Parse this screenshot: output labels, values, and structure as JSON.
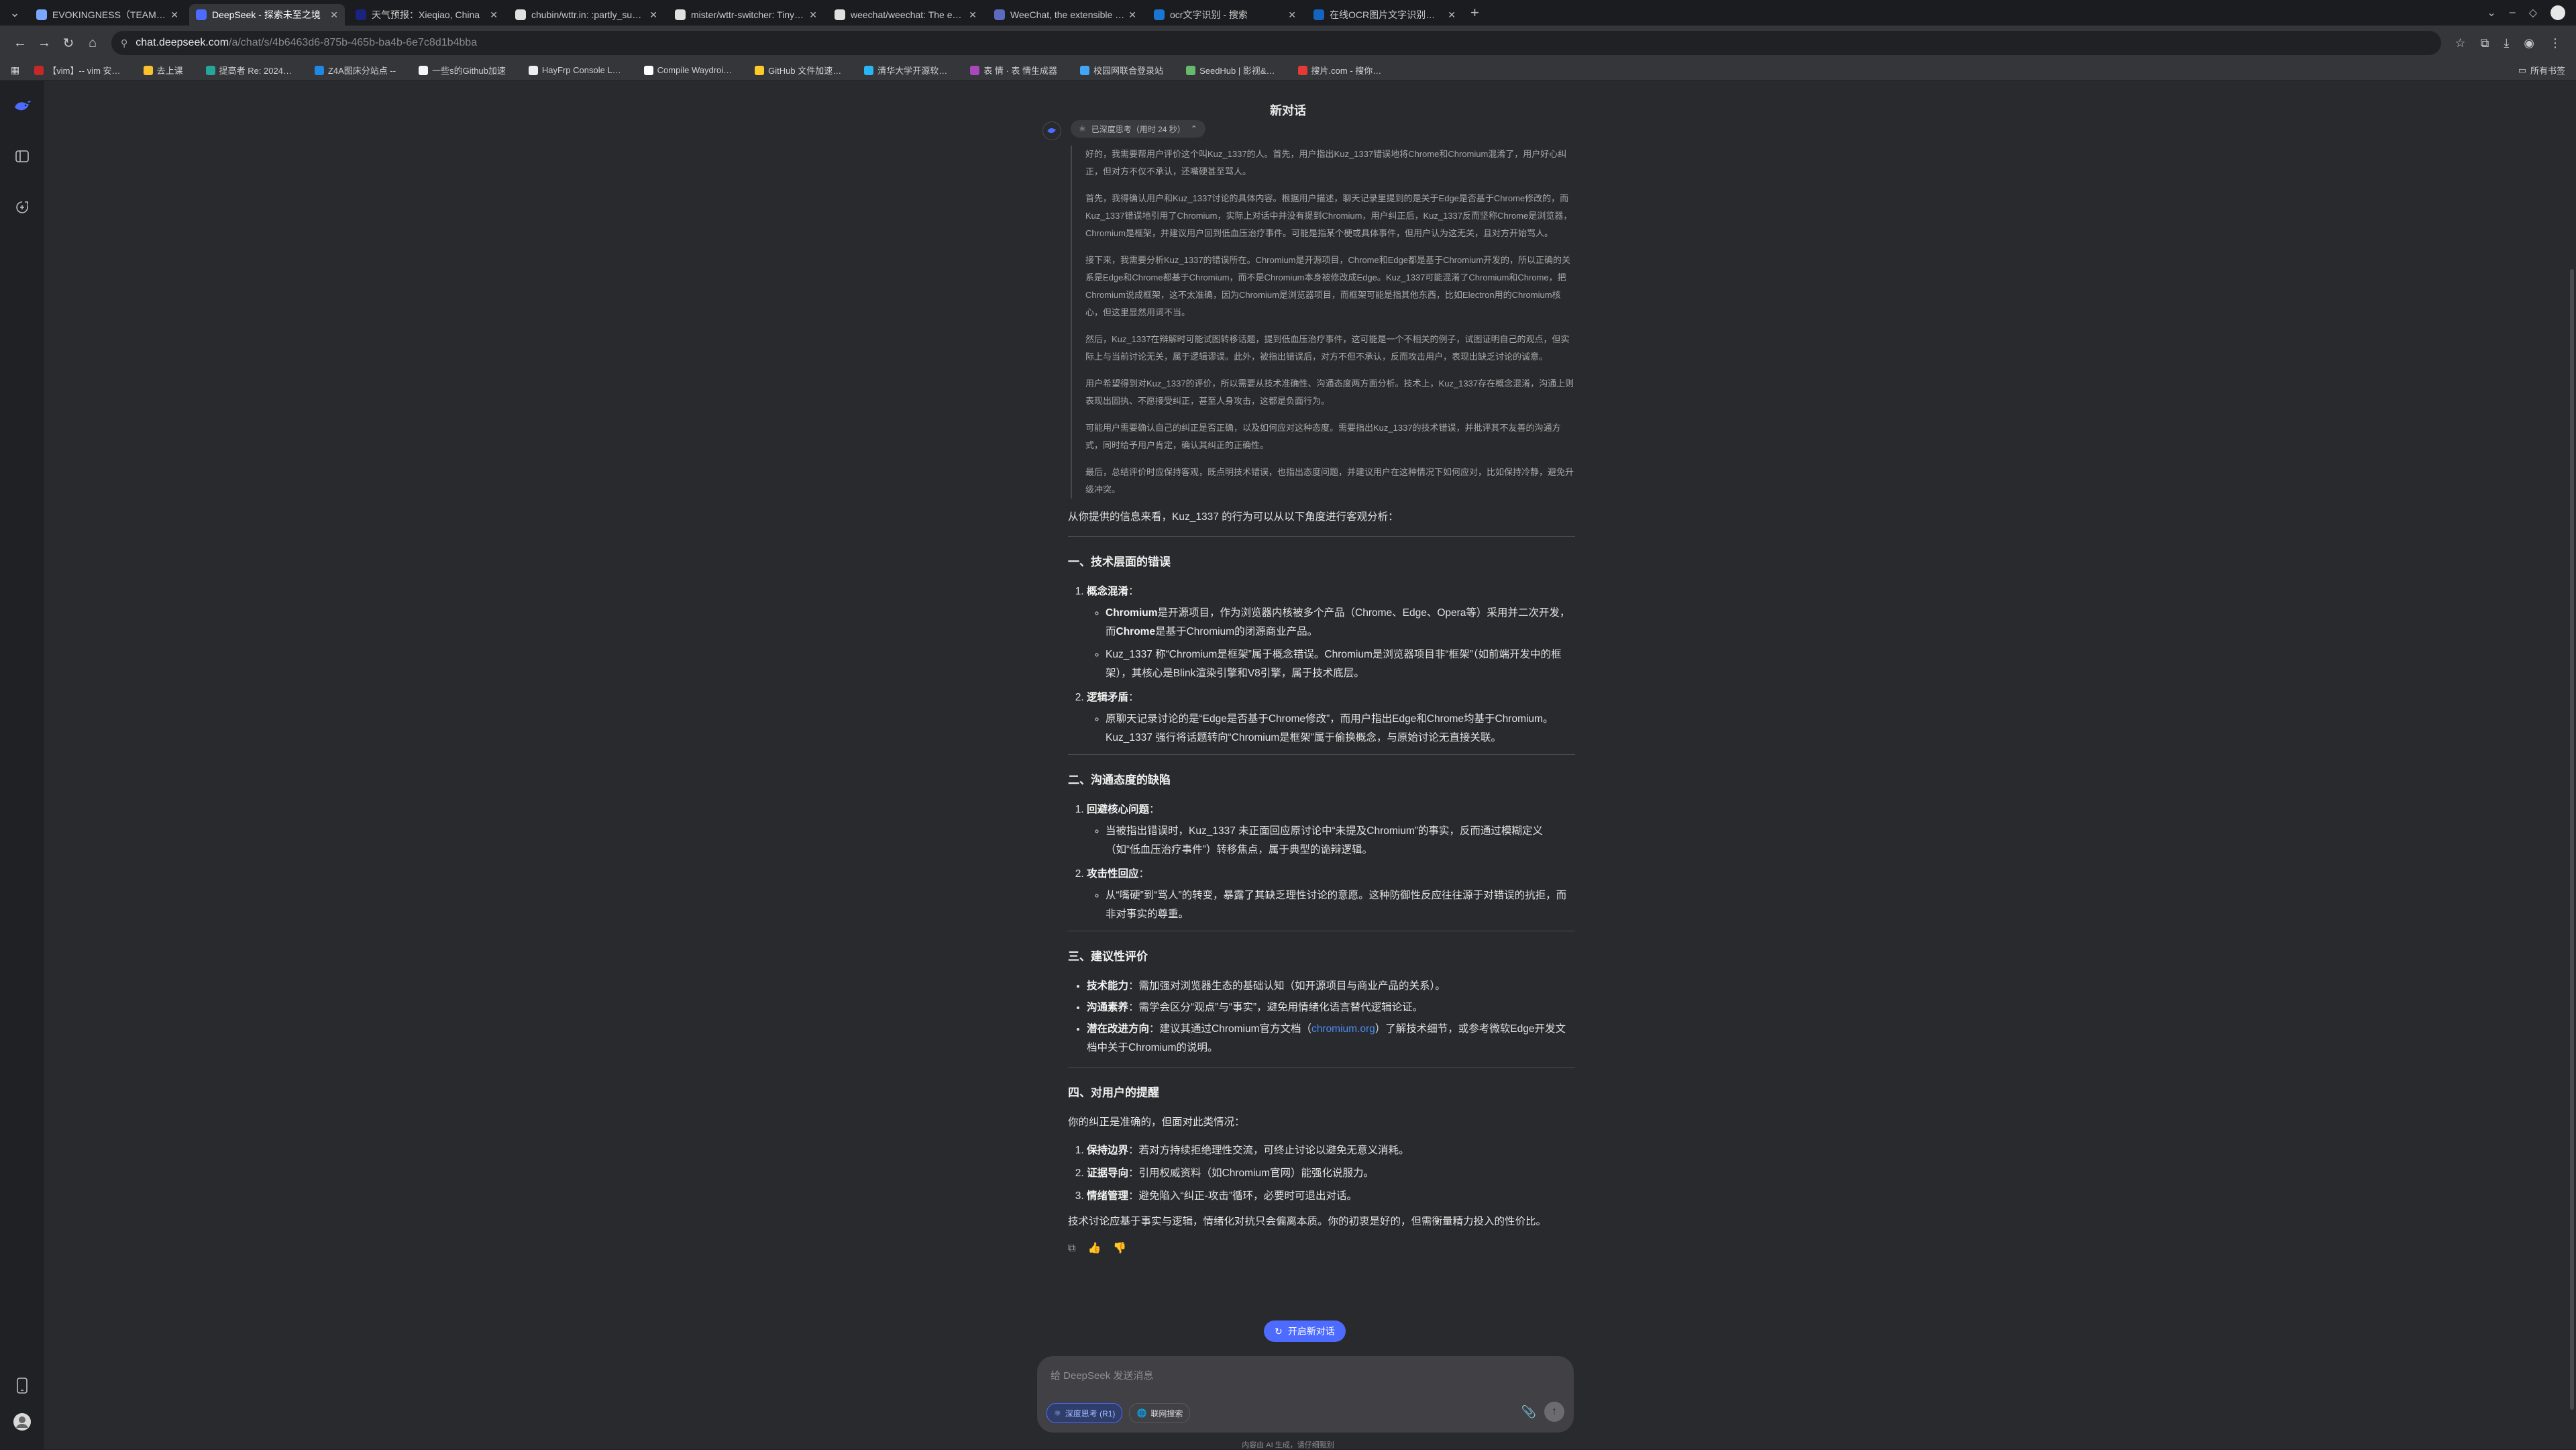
{
  "browser": {
    "tabs": [
      {
        "label": "EVOKINGNESS（TEAM EVOK）",
        "color": "#7aa7ff"
      },
      {
        "label": "DeepSeek - 探索未至之境",
        "color": "#4d6bfe"
      },
      {
        "label": "天气预报：Xieqiao, China",
        "color": "#1a237e"
      },
      {
        "label": "chubin/wttr.in: :partly_sunny:",
        "color": "#e0e0e0"
      },
      {
        "label": "mister/wttr-switcher: Tiny script",
        "color": "#e0e0e0"
      },
      {
        "label": "weechat/weechat: The extensible",
        "color": "#e0e0e0"
      },
      {
        "label": "WeeChat, the extensible chat client",
        "color": "#5c6bc0"
      },
      {
        "label": "ocr文字识别 - 搜索",
        "color": "#1976d2"
      },
      {
        "label": "在线OCR图片文字识别工具",
        "color": "#1565c0"
      }
    ],
    "url_host": "chat.deepseek.com",
    "url_path": "/a/chat/s/4b6463d6-875b-465b-ba4b-6e7c8d1b4bba",
    "bookmarks": [
      {
        "label": "【vim】-- vim 安…",
        "color": "#c62828"
      },
      {
        "label": "去上课",
        "color": "#fbc02d"
      },
      {
        "label": "提高者 Re: 2024…",
        "color": "#26a69a"
      },
      {
        "label": "Z4A图床分站点 --",
        "color": "#1e88e5"
      },
      {
        "label": "一些s的Github加速",
        "color": "#f5f5f5"
      },
      {
        "label": "HayFrp Console L…",
        "color": "#eeeeee"
      },
      {
        "label": "Compile Waydroi…",
        "color": "#ffffff"
      },
      {
        "label": "GitHub 文件加速…",
        "color": "#ffca28"
      },
      {
        "label": "清华大学开源软…",
        "color": "#29b6f6"
      },
      {
        "label": "表 情 · 表 情生成器",
        "color": "#ab47bc"
      },
      {
        "label": "校园网联合登录站",
        "color": "#42a5f5"
      },
      {
        "label": "SeedHub | 影视&…",
        "color": "#66bb6a"
      },
      {
        "label": "搜片.com - 搜你…",
        "color": "#e53935"
      }
    ],
    "all_bookmarks_label": "所有书签"
  },
  "app": {
    "title": "新对话",
    "think_label": "已深度思考（用时 24 秒）",
    "thoughts": [
      "好的，我需要帮用户评价这个叫Kuz_1337的人。首先，用户指出Kuz_1337错误地将Chrome和Chromium混淆了，用户好心纠正，但对方不仅不承认，还嘴硬甚至骂人。",
      "首先，我得确认用户和Kuz_1337讨论的具体内容。根据用户描述，聊天记录里提到的是关于Edge是否基于Chrome修改的，而Kuz_1337错误地引用了Chromium，实际上对话中并没有提到Chromium，用户纠正后，Kuz_1337反而坚称Chrome是浏览器，Chromium是框架，并建议用户回到低血压治疗事件。可能是指某个梗或具体事件，但用户认为这无关，且对方开始骂人。",
      "接下来，我需要分析Kuz_1337的错误所在。Chromium是开源项目，Chrome和Edge都是基于Chromium开发的，所以正确的关系是Edge和Chrome都基于Chromium，而不是Chromium本身被修改成Edge。Kuz_1337可能混淆了Chromium和Chrome，把Chromium说成框架，这不太准确，因为Chromium是浏览器项目，而框架可能是指其他东西，比如Electron用的Chromium核心，但这里显然用词不当。",
      "然后，Kuz_1337在辩解时可能试图转移话题，提到低血压治疗事件，这可能是一个不相关的例子，试图证明自己的观点，但实际上与当前讨论无关，属于逻辑谬误。此外，被指出错误后，对方不但不承认，反而攻击用户，表现出缺乏讨论的诚意。",
      "用户希望得到对Kuz_1337的评价，所以需要从技术准确性、沟通态度两方面分析。技术上，Kuz_1337存在概念混淆，沟通上则表现出固执、不愿接受纠正，甚至人身攻击，这都是负面行为。",
      "可能用户需要确认自己的纠正是否正确，以及如何应对这种态度。需要指出Kuz_1337的技术错误，并批评其不友善的沟通方式，同时给予用户肯定，确认其纠正的正确性。",
      "最后，总结评价时应保持客观，既点明技术错误，也指出态度问题，并建议用户在这种情况下如何应对，比如保持冷静，避免升级冲突。"
    ],
    "intro": "从你提供的信息来看，Kuz_1337 的行为可以从以下角度进行客观分析：",
    "s1": {
      "title": "一、技术层面的错误",
      "i1_title": "概念混淆",
      "i1_a_bold1": "Chromium",
      "i1_a_t1": "是开源项目，作为浏览器内核被多个产品（Chrome、Edge、Opera等）采用并二次开发，而",
      "i1_a_bold2": "Chrome",
      "i1_a_t2": "是基于Chromium的闭源商业产品。",
      "i1_b": "Kuz_1337 称“Chromium是框架”属于概念错误。Chromium是浏览器项目非“框架”（如前端开发中的框架），其核心是Blink渲染引擎和V8引擎，属于技术底层。",
      "i2_title": "逻辑矛盾",
      "i2_a": "原聊天记录讨论的是“Edge是否基于Chrome修改”，而用户指出Edge和Chrome均基于Chromium。Kuz_1337 强行将话题转向“Chromium是框架”属于偷换概念，与原始讨论无直接关联。"
    },
    "s2": {
      "title": "二、沟通态度的缺陷",
      "i1_title": "回避核心问题",
      "i1_a": "当被指出错误时，Kuz_1337 未正面回应原讨论中“未提及Chromium”的事实，反而通过模糊定义（如“低血压治疗事件”）转移焦点，属于典型的诡辩逻辑。",
      "i2_title": "攻击性回应",
      "i2_a": "从“嘴硬”到“骂人”的转变，暴露了其缺乏理性讨论的意愿。这种防御性反应往往源于对错误的抗拒，而非对事实的尊重。"
    },
    "s3": {
      "title": "三、建议性评价",
      "b1_label": "技术能力",
      "b1_text": "：需加强对浏览器生态的基础认知（如开源项目与商业产品的关系）。",
      "b2_label": "沟通素养",
      "b2_text": "：需学会区分“观点”与“事实”，避免用情绪化语言替代逻辑论证。",
      "b3_label": "潜在改进方向",
      "b3_text1": "：建议其通过Chromium官方文档（",
      "b3_link": "chromium.org",
      "b3_text2": "）了解技术细节，或参考微软Edge开发文档中关于Chromium的说明。"
    },
    "s4": {
      "title": "四、对用户的提醒",
      "intro": "你的纠正是准确的，但面对此类情况：",
      "i1_label": "保持边界",
      "i1_text": "：若对方持续拒绝理性交流，可终止讨论以避免无意义消耗。",
      "i2_label": "证据导向",
      "i2_text": "：引用权威资料（如Chromium官网）能强化说服力。",
      "i3_label": "情绪管理",
      "i3_text": "：避免陷入“纠正-攻击”循环，必要时可退出对话。"
    },
    "closing": "技术讨论应基于事实与逻辑，情绪化对抗只会偏离本质。你的初衷是好的，但需衡量精力投入的性价比。",
    "new_chat_label": "开启新对话",
    "composer": {
      "placeholder": "给 DeepSeek 发送消息",
      "deep_think": "深度思考 (R1)",
      "web_search": "联网搜索"
    },
    "disclaimer": "内容由 AI 生成，请仔细甄别",
    "accent": "#4d6bfe"
  }
}
